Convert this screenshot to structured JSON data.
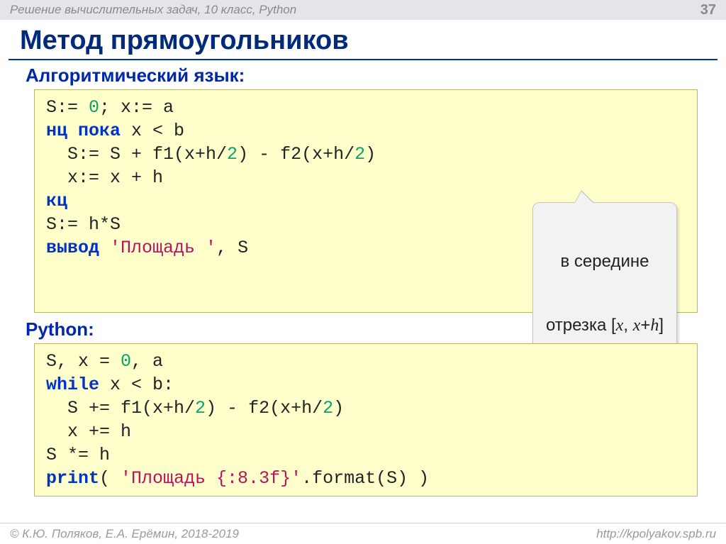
{
  "header": {
    "breadcrumb": "Решение вычислительных задач, 10 класс, Python",
    "page_number": "37"
  },
  "title": "Метод прямоугольников",
  "section1": {
    "label": "Алгоритмический язык:"
  },
  "code_alg": {
    "l1a": "S:= ",
    "l1b": "0",
    "l1c": "; x:= a",
    "l2a": "нц пока",
    "l2b": " x < b",
    "l3a": "  S:= S + f1(x+h/",
    "l3b": "2",
    "l3c": ") - f2(x+h/",
    "l3d": "2",
    "l3e": ")",
    "l4": "  x:= x + h",
    "l5": "кц",
    "l6": "S:= h*S",
    "l7a": "вывод",
    "l7b": " ",
    "l7c": "'Площадь '",
    "l7d": ", S"
  },
  "callout": {
    "line1": "в середине",
    "line2_pre": "отрезка [",
    "line2_x1": "x",
    "line2_mid": ", ",
    "line2_x2": "x",
    "line2_plus": "+",
    "line2_h": "h",
    "line2_suf": "]"
  },
  "section2": {
    "label": "Python:"
  },
  "code_py": {
    "l1a": "S, x = ",
    "l1b": "0",
    "l1c": ", a",
    "l2a": "while",
    "l2b": " x < b:",
    "l3a": "  S += f1(x+h/",
    "l3b": "2",
    "l3c": ") - f2(x+h/",
    "l3d": "2",
    "l3e": ")",
    "l4": "  x += h",
    "l5": "S *= h",
    "l6a": "print",
    "l6b": "( ",
    "l6c": "'Площадь {:8.3f}'",
    "l6d": ".format(S) )"
  },
  "footer": {
    "left": "© К.Ю. Поляков, Е.А. Ерёмин, 2018-2019",
    "right": "http://kpolyakov.spb.ru"
  }
}
